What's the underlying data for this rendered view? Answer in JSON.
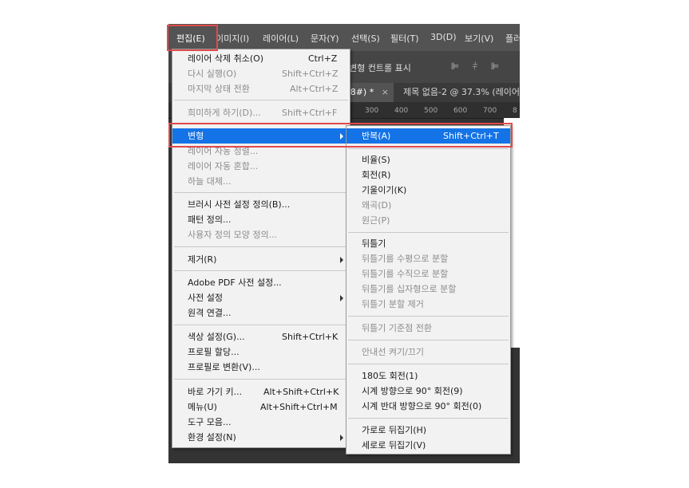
{
  "menubar": {
    "items": [
      "편집(E)",
      "이미지(I)",
      "레이어(L)",
      "문자(Y)",
      "선택(S)",
      "필터(T)",
      "3D(D)",
      "보기(V)",
      "플러"
    ]
  },
  "options_bar": {
    "text": "변형 컨트롤 표시",
    "align_icons": [
      "align-left-icon",
      "align-center-icon",
      "align-right-icon"
    ]
  },
  "tabs": {
    "doc1": "/8#) *",
    "doc1_close": "×",
    "doc2": "제목 없음-2 @ 37.3% (레이어"
  },
  "ruler": [
    "300",
    "400",
    "500",
    "600",
    "700",
    "8"
  ],
  "edit_menu": {
    "items": [
      {
        "label": "레이어 삭제 취소(O)",
        "shortcut": "Ctrl+Z"
      },
      {
        "label": "다시 실행(O)",
        "shortcut": "Shift+Ctrl+Z"
      },
      {
        "label": "마지막 상태 전환",
        "shortcut": "Alt+Ctrl+Z"
      },
      {
        "label": "희미하게 하기(D)...",
        "shortcut": "Shift+Ctrl+F"
      },
      {
        "label": "변형",
        "shortcut": ""
      },
      {
        "label": "레이어 자동 정렬...",
        "shortcut": ""
      },
      {
        "label": "레이어 자동 혼합...",
        "shortcut": ""
      },
      {
        "label": "하늘 대체...",
        "shortcut": ""
      },
      {
        "label": "브러시 사전 설정 정의(B)...",
        "shortcut": ""
      },
      {
        "label": "패턴 정의...",
        "shortcut": ""
      },
      {
        "label": "사용자 정의 모양 정의...",
        "shortcut": ""
      },
      {
        "label": "제거(R)",
        "shortcut": ""
      },
      {
        "label": "Adobe PDF 사전 설정...",
        "shortcut": ""
      },
      {
        "label": "사전 설정",
        "shortcut": ""
      },
      {
        "label": "원격 연결...",
        "shortcut": ""
      },
      {
        "label": "색상 설정(G)...",
        "shortcut": "Shift+Ctrl+K"
      },
      {
        "label": "프로필 할당...",
        "shortcut": ""
      },
      {
        "label": "프로필로 변환(V)...",
        "shortcut": ""
      },
      {
        "label": "바로 가기 키...",
        "shortcut": "Alt+Shift+Ctrl+K"
      },
      {
        "label": "메뉴(U)",
        "shortcut": "Alt+Shift+Ctrl+M"
      },
      {
        "label": "도구 모음...",
        "shortcut": ""
      },
      {
        "label": "환경 설정(N)",
        "shortcut": ""
      }
    ]
  },
  "transform_menu": {
    "items": [
      {
        "label": "반복(A)",
        "shortcut": "Shift+Ctrl+T"
      },
      {
        "label": "비율(S)",
        "shortcut": ""
      },
      {
        "label": "회전(R)",
        "shortcut": ""
      },
      {
        "label": "기울이기(K)",
        "shortcut": ""
      },
      {
        "label": "왜곡(D)",
        "shortcut": ""
      },
      {
        "label": "원근(P)",
        "shortcut": ""
      },
      {
        "label": "뒤틀기",
        "shortcut": ""
      },
      {
        "label": "뒤틀기를 수평으로 분할",
        "shortcut": ""
      },
      {
        "label": "뒤틀기를 수직으로 분할",
        "shortcut": ""
      },
      {
        "label": "뒤틀기를 십자형으로 분할",
        "shortcut": ""
      },
      {
        "label": "뒤틀기 분할 제거",
        "shortcut": ""
      },
      {
        "label": "뒤틀기 기준점 전환",
        "shortcut": ""
      },
      {
        "label": "안내선 켜기/끄기",
        "shortcut": ""
      },
      {
        "label": "180도 회전(1)",
        "shortcut": ""
      },
      {
        "label": "시계 방향으로 90° 회전(9)",
        "shortcut": ""
      },
      {
        "label": "시계 반대 방향으로 90° 회전(0)",
        "shortcut": ""
      },
      {
        "label": "가로로 뒤집기(H)",
        "shortcut": ""
      },
      {
        "label": "세로로 뒤집기(V)",
        "shortcut": ""
      }
    ]
  },
  "colors": {
    "highlight": "#1473e6",
    "annotation": "#e04a4a",
    "menubar": "#535353"
  }
}
